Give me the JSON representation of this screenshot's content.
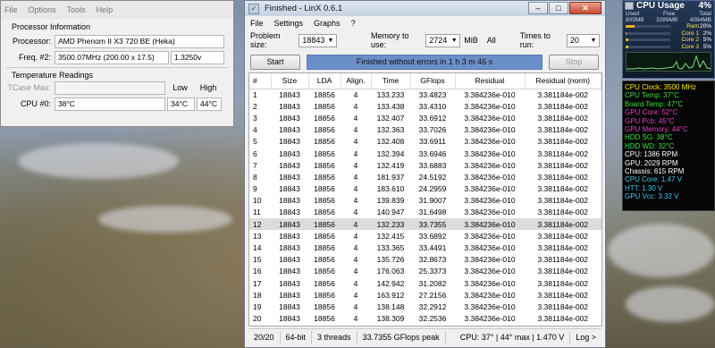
{
  "cpuz": {
    "menu": [
      "File",
      "Options",
      "Tools",
      "Help"
    ],
    "section_processor": "Processor Information",
    "processor_label": "Processor:",
    "processor_value": "AMD Phenom II X3 720 BE (Heka)",
    "freq_label": "Freq. #2:",
    "freq_value": "3500.07MHz (200.00 x 17.5)",
    "voltage": "1.3250v",
    "section_temp": "Temperature Readings",
    "tcase_label": "TCase Max:",
    "low_label": "Low",
    "high_label": "High",
    "cpu0_label": "CPU #0:",
    "cpu0_value": "38°C",
    "cpu0_low": "34°C",
    "cpu0_high": "44°C"
  },
  "linx": {
    "title": "Finished - LinX 0.6.1",
    "menu": [
      "File",
      "Settings",
      "Graphs",
      "?"
    ],
    "problem_size_label": "Problem size:",
    "problem_size_value": "18843",
    "memory_label": "Memory to use:",
    "memory_value": "2724",
    "memory_unit": "MiB",
    "all_label": "All",
    "times_label": "Times to run:",
    "times_value": "20",
    "start_label": "Start",
    "stop_label": "Stop",
    "progress_text": "Finished without errors in 1 h 3 m 46 s",
    "progress_fraction": 1.0,
    "columns": [
      "#",
      "Size",
      "LDA",
      "Align.",
      "Time",
      "GFlops",
      "Residual",
      "Residual (norm)"
    ],
    "rows": [
      [
        "1",
        "18843",
        "18856",
        "4",
        "133.233",
        "33.4823",
        "3.384236e-010",
        "3.381184e-002"
      ],
      [
        "2",
        "18843",
        "18856",
        "4",
        "133.438",
        "33.4310",
        "3.384236e-010",
        "3.381184e-002"
      ],
      [
        "3",
        "18843",
        "18856",
        "4",
        "132.407",
        "33.6912",
        "3.384236e-010",
        "3.381184e-002"
      ],
      [
        "4",
        "18843",
        "18856",
        "4",
        "132.363",
        "33.7026",
        "3.384236e-010",
        "3.381184e-002"
      ],
      [
        "5",
        "18843",
        "18856",
        "4",
        "132.408",
        "33.6911",
        "3.384236e-010",
        "3.381184e-002"
      ],
      [
        "6",
        "18843",
        "18856",
        "4",
        "132.394",
        "33.6946",
        "3.384236e-010",
        "3.381184e-002"
      ],
      [
        "7",
        "18843",
        "18856",
        "4",
        "132.419",
        "33.6883",
        "3.384236e-010",
        "3.381184e-002"
      ],
      [
        "8",
        "18843",
        "18856",
        "4",
        "181.937",
        "24.5192",
        "3.384236e-010",
        "3.381184e-002"
      ],
      [
        "9",
        "18843",
        "18856",
        "4",
        "183.610",
        "24.2959",
        "3.384236e-010",
        "3.381184e-002"
      ],
      [
        "10",
        "18843",
        "18856",
        "4",
        "139.839",
        "31.9007",
        "3.384236e-010",
        "3.381184e-002"
      ],
      [
        "11",
        "18843",
        "18856",
        "4",
        "140.947",
        "31.6498",
        "3.384236e-010",
        "3.381184e-002"
      ],
      [
        "12",
        "18843",
        "18856",
        "4",
        "132.233",
        "33.7355",
        "3.384236e-010",
        "3.381184e-002"
      ],
      [
        "13",
        "18843",
        "18856",
        "4",
        "132.415",
        "33.6892",
        "3.384236e-010",
        "3.381184e-002"
      ],
      [
        "14",
        "18843",
        "18856",
        "4",
        "133.365",
        "33.4491",
        "3.384236e-010",
        "3.381184e-002"
      ],
      [
        "15",
        "18843",
        "18856",
        "4",
        "135.726",
        "32.8673",
        "3.384236e-010",
        "3.381184e-002"
      ],
      [
        "16",
        "18843",
        "18856",
        "4",
        "176.063",
        "25.3373",
        "3.384236e-010",
        "3.381184e-002"
      ],
      [
        "17",
        "18843",
        "18856",
        "4",
        "142.942",
        "31.2082",
        "3.384236e-010",
        "3.381184e-002"
      ],
      [
        "18",
        "18843",
        "18856",
        "4",
        "163.912",
        "27.2156",
        "3.384236e-010",
        "3.381184e-002"
      ],
      [
        "19",
        "18843",
        "18856",
        "4",
        "138.148",
        "32.2912",
        "3.384236e-010",
        "3.381184e-002"
      ],
      [
        "20",
        "18843",
        "18856",
        "4",
        "138.309",
        "32.2536",
        "3.384236e-010",
        "3.381184e-002"
      ]
    ],
    "selected_row": 12,
    "status": {
      "runs": "20/20",
      "bits": "64-bit",
      "threads": "3 threads",
      "peak": "33.7355 GFlops peak",
      "cpu": "CPU: 37° | 44° max | 1.470 V",
      "log": "Log >"
    }
  },
  "cpu_usage": {
    "title": "CPU Usage",
    "total": "4%",
    "used_label": "Used",
    "free_label": "Free",
    "total_label": "Total",
    "used": "805MB",
    "free": "3289MB",
    "total_mem": "4094MB",
    "items": [
      {
        "label": "Ram",
        "value": "20%",
        "level": 0.2
      },
      {
        "label": "Core 1",
        "value": "2%",
        "level": 0.02
      },
      {
        "label": "Core 2",
        "value": "5%",
        "level": 0.05
      },
      {
        "label": "Core 3",
        "value": "5%",
        "level": 0.05
      }
    ]
  },
  "sensors": [
    {
      "text": "CPU Clock: 3500 MHz",
      "color": "#ffe500"
    },
    {
      "text": "CPU Temp: 37°C",
      "color": "#38e038"
    },
    {
      "text": "Board Temp: 47°C",
      "color": "#38e038"
    },
    {
      "text": "GPU Core: 52°C",
      "color": "#e040c0"
    },
    {
      "text": "GPU Pcb: 45°C",
      "color": "#e040c0"
    },
    {
      "text": "GPU Memory: 44°C",
      "color": "#e040c0"
    },
    {
      "text": "HDD SG: 38°C",
      "color": "#38e038"
    },
    {
      "text": "HDD WD: 32°C",
      "color": "#38e038"
    },
    {
      "text": "CPU: 1386 RPM",
      "color": "#ffffff"
    },
    {
      "text": "GPU: 2029 RPM",
      "color": "#ffffff"
    },
    {
      "text": "Chassis: 615 RPM",
      "color": "#ffffff"
    },
    {
      "text": "CPU Core: 1.47 V",
      "color": "#40c8f0"
    },
    {
      "text": "HTT: 1.30 V",
      "color": "#40c8f0"
    },
    {
      "text": "GPU Vcc: 3.32 V",
      "color": "#40c8f0"
    }
  ]
}
